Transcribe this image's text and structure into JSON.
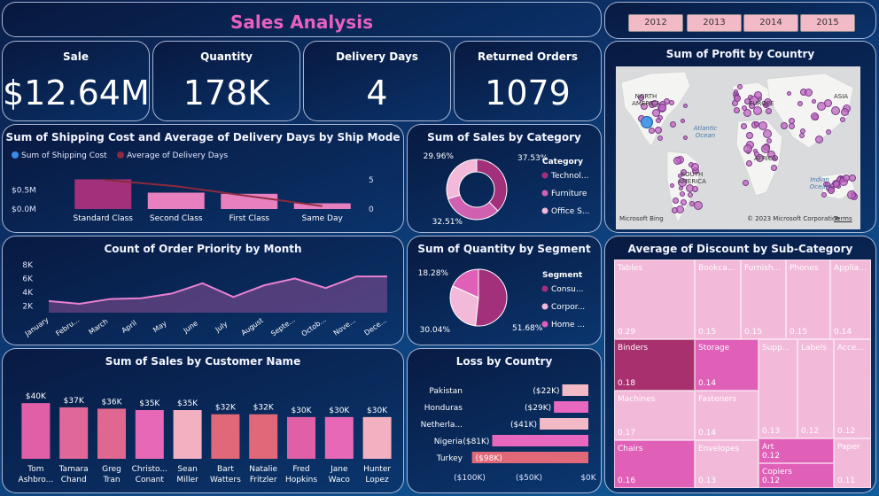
{
  "header": {
    "title": "Sales Analysis"
  },
  "years": [
    "2012",
    "2013",
    "2014",
    "2015"
  ],
  "kpis": [
    {
      "label": "Sale",
      "value": "$12.64M"
    },
    {
      "label": "Quantity",
      "value": "178K"
    },
    {
      "label": "Delivery Days",
      "value": "4"
    },
    {
      "label": "Returned Orders",
      "value": "1079"
    }
  ],
  "colors": {
    "accent_pink": "#e860c0",
    "bar_magenta": "#a2307a",
    "bar_pink": "#e880c0",
    "line_dark_red": "#8b2a3c",
    "light_pink": "#f2b9d9",
    "loss_pink": "#e860b8"
  },
  "map": {
    "title": "Sum of Profit by Country",
    "labels": {
      "na": "NORTH AMERICA",
      "sa": "SOUTH AMERICA",
      "europe": "EUROPE",
      "asia": "ASIA",
      "africa": "AFRICA"
    },
    "oceans": {
      "atlantic": "Atlantic Ocean",
      "indian": "Indian Ocean"
    },
    "brand": "Microsoft Bing",
    "copyright": "© 2023 Microsoft Corporation",
    "terms": "Terms"
  },
  "chart_data": [
    {
      "id": "shipping",
      "type": "bar",
      "title": "Sum of Shipping Cost and Average of Delivery Days by Ship Mode",
      "categories": [
        "Standard Class",
        "Second Class",
        "First Class",
        "Same Day"
      ],
      "series": [
        {
          "name": "Sum of Shipping Cost",
          "values": [
            0.78,
            0.43,
            0.4,
            0.15
          ],
          "axis": "left",
          "color": "#e880c0"
        },
        {
          "name": "Average of Delivery Days",
          "values": [
            5.0,
            3.9,
            2.2,
            0.5
          ],
          "axis": "right",
          "color": "#8b2a3c"
        }
      ],
      "yticks_left": [
        "$0.0M",
        "$0.5M"
      ],
      "yticks_right": [
        "0",
        "5"
      ],
      "ylim_left": [
        0,
        1.0
      ],
      "ylim_right": [
        0,
        6.5
      ]
    },
    {
      "id": "category",
      "type": "pie",
      "donut": true,
      "title": "Sum of Sales by Category",
      "legend_title": "Category",
      "labels": [
        "Technol...",
        "Furniture",
        "Office S..."
      ],
      "values": [
        37.53,
        32.51,
        29.96
      ],
      "value_labels": [
        "37.53%",
        "32.51%",
        "29.96%"
      ],
      "colors": [
        "#a2307a",
        "#d060b0",
        "#f2b9d9"
      ]
    },
    {
      "id": "priority",
      "type": "area",
      "title": "Count of Order Priority by Month",
      "categories": [
        "January",
        "Febru...",
        "March",
        "April",
        "May",
        "June",
        "July",
        "August",
        "Septe...",
        "Octob...",
        "Nove...",
        "Dece..."
      ],
      "values": [
        2700,
        2300,
        3000,
        3100,
        3800,
        5300,
        3300,
        5000,
        6000,
        4600,
        6300,
        6300
      ],
      "yticks": [
        "2K",
        "4K",
        "6K",
        "8K"
      ],
      "ylim": [
        1000,
        8000
      ]
    },
    {
      "id": "segment",
      "type": "pie",
      "title": "Sum of Quantity by Segment",
      "legend_title": "Segment",
      "labels": [
        "Consu...",
        "Corpor...",
        "Home ..."
      ],
      "values": [
        51.68,
        30.04,
        18.28
      ],
      "value_labels": [
        "51.68%",
        "30.04%",
        "18.28%"
      ],
      "colors": [
        "#a2307a",
        "#f2b9d9",
        "#e060b8"
      ]
    },
    {
      "id": "customer",
      "type": "bar",
      "title": "Sum of Sales by Customer Name",
      "categories": [
        "Tom Ashbro...",
        "Tamara Chand",
        "Greg Tran",
        "Christo... Conant",
        "Sean Miller",
        "Bart Watters",
        "Natalie Fritzler",
        "Fred Hopkins",
        "Jane Waco",
        "Hunter Lopez"
      ],
      "values": [
        40,
        37,
        36,
        35,
        35,
        32,
        32,
        30,
        30,
        30
      ],
      "value_labels": [
        "$40K",
        "$37K",
        "$36K",
        "$35K",
        "$35K",
        "$32K",
        "$32K",
        "$30K",
        "$30K",
        "$30K"
      ],
      "colors": [
        "#e060a8",
        "#e06898",
        "#e06890",
        "#e868b8",
        "#f2b0c0",
        "#e06878",
        "#e06878",
        "#e060a8",
        "#e868b8",
        "#f2b0c0"
      ],
      "ylim": [
        0,
        42
      ]
    },
    {
      "id": "loss",
      "type": "bar",
      "orientation": "horizontal",
      "title": "Loss by Country",
      "categories": [
        "Pakistan",
        "Honduras",
        "Netherla...",
        "Nigeria",
        "Turkey"
      ],
      "values": [
        -22,
        -29,
        -41,
        -81,
        -98
      ],
      "value_labels": [
        "($22K)",
        "($29K)",
        "($41K)",
        "($81K)",
        "($98K)"
      ],
      "colors": [
        "#f2b9c6",
        "#e868c0",
        "#f2b9c6",
        "#e868c0",
        "#e06878"
      ],
      "xticks": [
        "($100K)",
        "($50K)",
        "$0K"
      ],
      "xlim": [
        -100,
        0
      ]
    },
    {
      "id": "discount",
      "type": "heatmap",
      "subtype": "treemap",
      "title": "Average of Discount by Sub-Category",
      "items": [
        {
          "name": "Tables",
          "value": "0.29",
          "color": "#f2b9d9"
        },
        {
          "name": "Bookca...",
          "value": "0.15",
          "color": "#f2b9d9"
        },
        {
          "name": "Furnish...",
          "value": "0.15",
          "color": "#f2b9d9"
        },
        {
          "name": "Phones",
          "value": "0.15",
          "color": "#f2b9d9"
        },
        {
          "name": "Applia...",
          "value": "0.14",
          "color": "#f2b9d9"
        },
        {
          "name": "Binders",
          "value": "0.18",
          "color": "#a8306e"
        },
        {
          "name": "Storage",
          "value": "0.14",
          "color": "#e060b8"
        },
        {
          "name": "Supp...",
          "value": "0.13",
          "color": "#f2b9d9"
        },
        {
          "name": "Labels",
          "value": "0.12",
          "color": "#f2b9d9"
        },
        {
          "name": "Acce...",
          "value": "0.12",
          "color": "#f2b9d9"
        },
        {
          "name": "Machines",
          "value": "0.17",
          "color": "#f2b9d9"
        },
        {
          "name": "Fasteners",
          "value": "0.14",
          "color": "#f2b9d9"
        },
        {
          "name": "Art",
          "value": "0.12",
          "color": "#e060b8"
        },
        {
          "name": "Paper",
          "value": "0.11",
          "color": "#f2b9d9"
        },
        {
          "name": "Chairs",
          "value": "0.16",
          "color": "#e060b8"
        },
        {
          "name": "Envelopes",
          "value": "0.13",
          "color": "#f2b9d9"
        },
        {
          "name": "Copiers",
          "value": "0.12",
          "color": "#e060b8"
        }
      ]
    }
  ]
}
